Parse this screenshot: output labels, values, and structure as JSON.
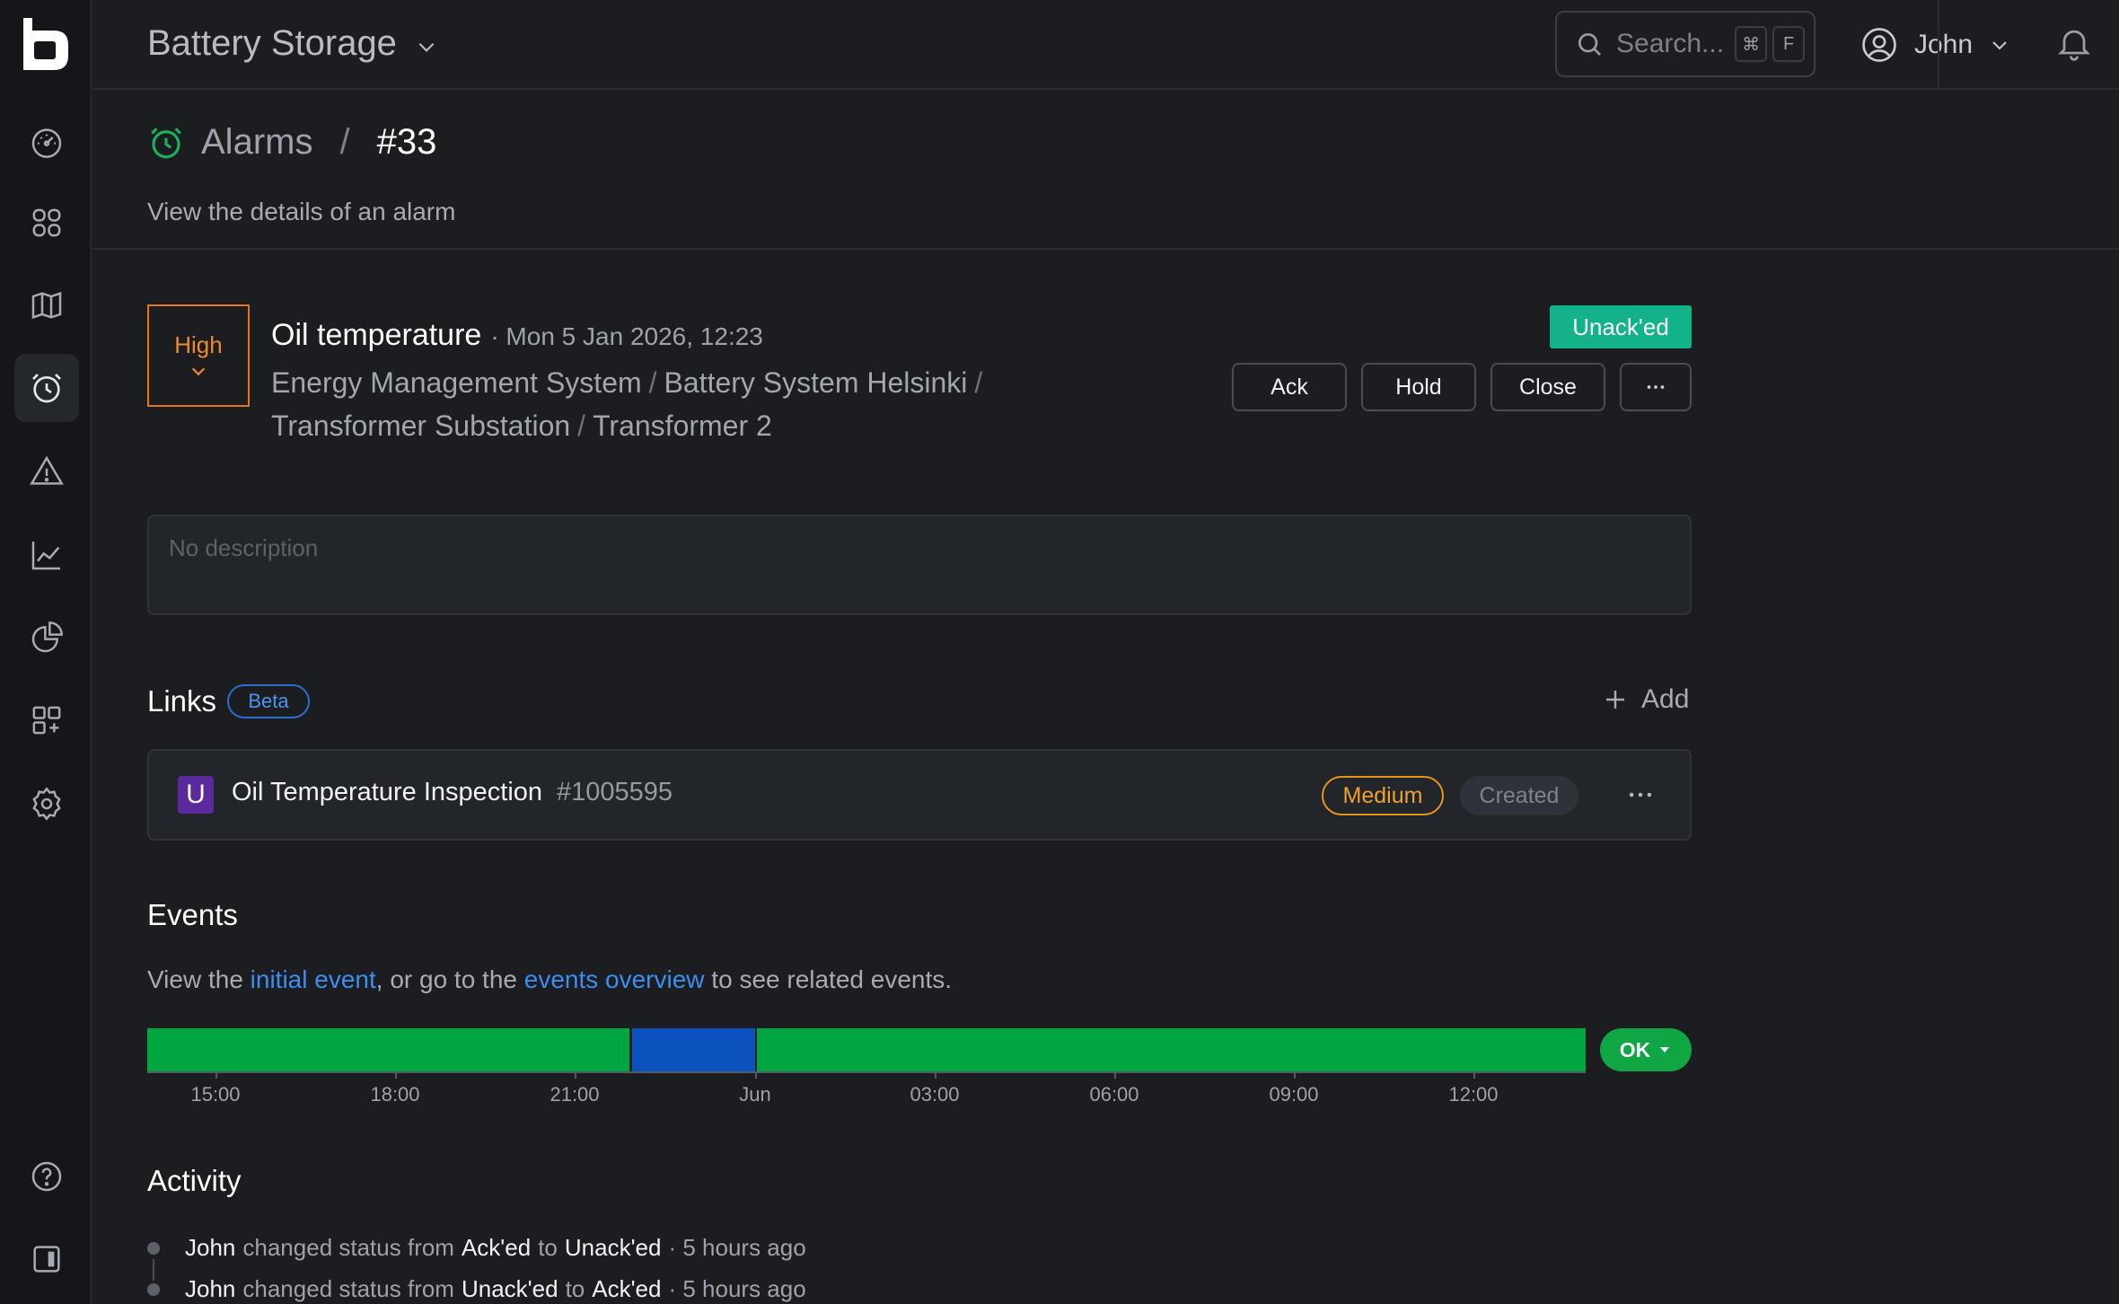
{
  "header": {
    "app_title": "Battery Storage",
    "search_placeholder": "Search...",
    "search_key1": "⌘",
    "search_key2": "F",
    "user_name": "John"
  },
  "breadcrumb": {
    "parent": "Alarms",
    "separator": "/",
    "current": "#33"
  },
  "page_subtitle": "View the details of an alarm",
  "alarm": {
    "severity": "High",
    "title": "Oil temperature",
    "time": "· Mon 5 Jan 2026, 12:23",
    "path": [
      "Energy Management System",
      "Battery System Helsinki",
      "Transformer Substation",
      "Transformer 2"
    ],
    "path_separator": "/",
    "status": "Unack'ed",
    "actions": [
      "Ack",
      "Hold",
      "Close"
    ],
    "description_placeholder": "No description"
  },
  "links": {
    "title": "Links",
    "beta": "Beta",
    "add_label": "Add",
    "items": [
      {
        "icon_letter": "U",
        "title": "Oil Temperature Inspection",
        "id": "#1005595",
        "priority": "Medium",
        "state": "Created"
      }
    ]
  },
  "events": {
    "title": "Events",
    "text_1": "View the ",
    "link_1": "initial event",
    "text_2": ", or go to the ",
    "link_2": "events overview",
    "text_3": " to see related events.",
    "timeline_labels": [
      "15:00",
      "18:00",
      "21:00",
      "Jun",
      "03:00",
      "06:00",
      "09:00",
      "12:00"
    ],
    "state_label": "OK",
    "colors": {
      "ok": "#00a63f",
      "acked": "#0b52bf"
    }
  },
  "activity": {
    "title": "Activity",
    "items": [
      {
        "user": "John",
        "verb": "changed status from",
        "from": "Ack'ed",
        "to_word": "to",
        "to": "Unack'ed",
        "time": "· 5 hours ago"
      },
      {
        "user": "John",
        "verb": "changed status from",
        "from": "Unack'ed",
        "to_word": "to",
        "to": "Ack'ed",
        "time": "· 5 hours ago"
      }
    ]
  }
}
